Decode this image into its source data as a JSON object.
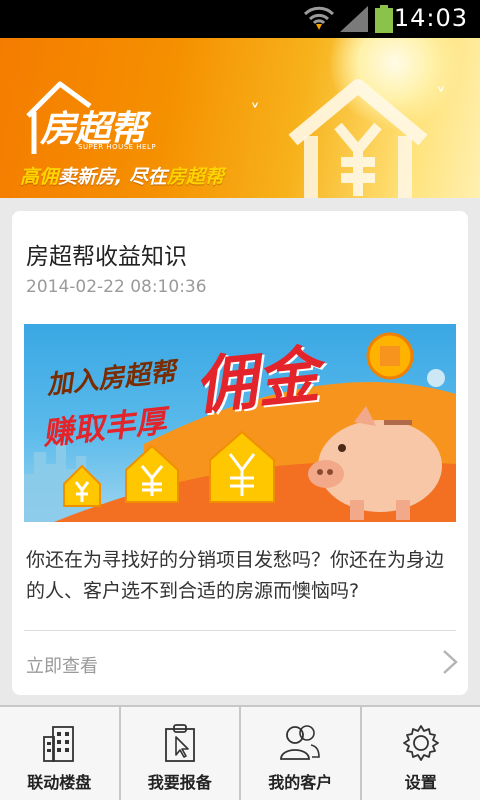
{
  "status_bar": {
    "time": "14:03"
  },
  "banner": {
    "logo_text": "房超帮",
    "logo_sub": "SUPER HOUSE HELP",
    "slogan_part1": "高佣",
    "slogan_part2": "卖新房, 尽在",
    "slogan_part3": "房超帮"
  },
  "article": {
    "title": "房超帮收益知识",
    "date": "2014-02-22 08:10:36",
    "image_text_line1": "加入房超帮",
    "image_text_line2": "赚取丰厚",
    "image_text_big": "佣金",
    "description": "你还在为寻找好的分销项目发愁吗？你还在为身边的人、客户选不到合适的房源而懊恼吗?",
    "more_label": "立即查看"
  },
  "bottom_nav": {
    "items": [
      {
        "label": "联动楼盘",
        "icon": "building-icon"
      },
      {
        "label": "我要报备",
        "icon": "clipboard-cursor-icon"
      },
      {
        "label": "我的客户",
        "icon": "users-icon"
      },
      {
        "label": "设置",
        "icon": "gear-icon"
      }
    ]
  },
  "colors": {
    "accent": "#f59000",
    "card_bg": "#ffffff",
    "page_bg": "#e9e9e9",
    "promo_red": "#e4242b"
  }
}
